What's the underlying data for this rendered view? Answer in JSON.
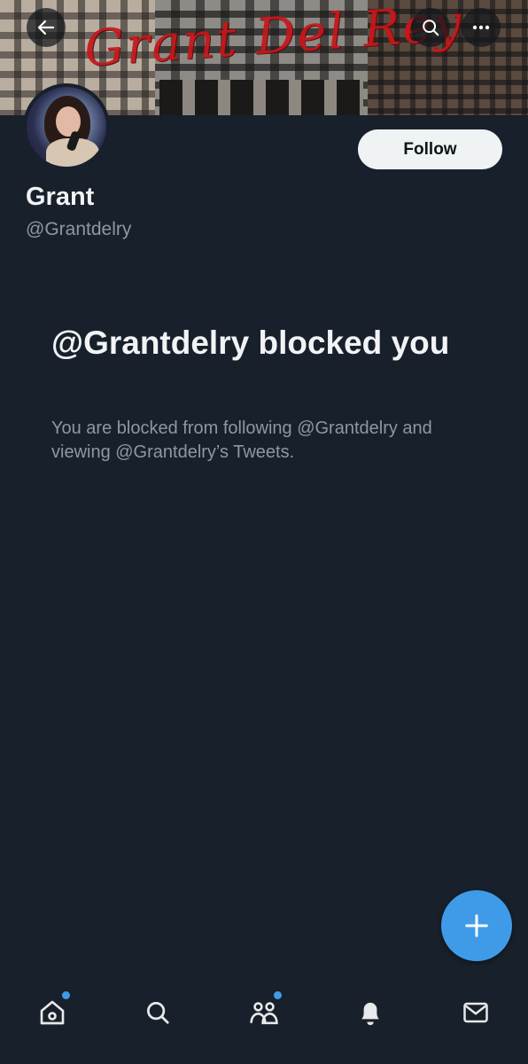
{
  "banner": {
    "script_text": "Grant Del Rey"
  },
  "header": {
    "back_icon": "arrow-left-icon",
    "search_icon": "search-icon",
    "more_icon": "more-horizontal-icon"
  },
  "profile": {
    "display_name": "Grant",
    "handle": "@Grantdelry",
    "follow_label": "Follow"
  },
  "blocked": {
    "title": "@Grantdelry blocked you",
    "description": "You are blocked from following @Grantdelry and viewing @Grantdelry’s Tweets."
  },
  "fab": {
    "icon": "plus-icon"
  },
  "bottom_nav": {
    "items": [
      {
        "icon": "home-icon",
        "has_badge": true
      },
      {
        "icon": "search-icon",
        "has_badge": false
      },
      {
        "icon": "communities-icon",
        "has_badge": true
      },
      {
        "icon": "notifications-bell-icon",
        "has_badge": false
      },
      {
        "icon": "messages-envelope-icon",
        "has_badge": false
      }
    ]
  },
  "colors": {
    "background": "#18202b",
    "accent": "#3f9be8",
    "banner_script": "#c8161a",
    "secondary_text": "#8b98a5"
  }
}
